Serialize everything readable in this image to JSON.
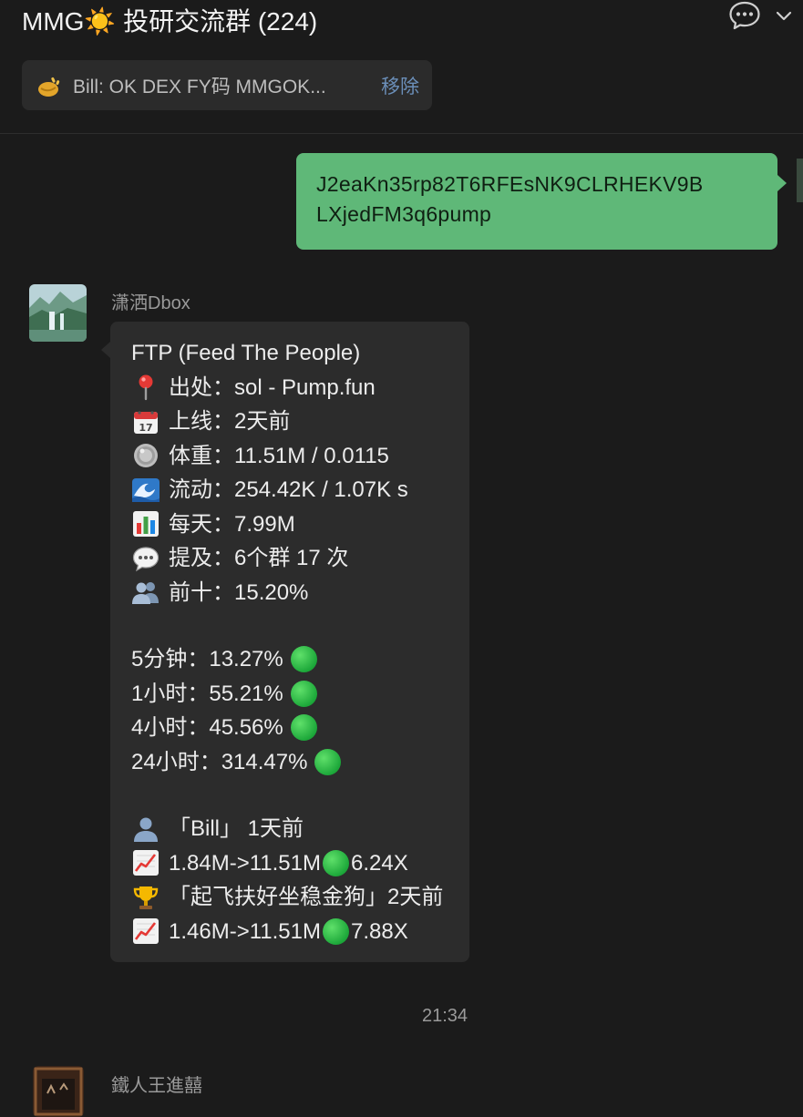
{
  "header": {
    "title": "MMG☀️ 投研交流群 (224)",
    "icons": [
      "chat-bubble-icon",
      "chevron-down-icon"
    ]
  },
  "pinned": {
    "icon": "pinned-emoji-icon",
    "text": "Bill: OK DEX FY码  MMGOK...",
    "remove_label": "移除"
  },
  "messages": {
    "outgoing": {
      "line1": "J2eaKn35rp82T6RFEsNK9CLRHEKV9B",
      "line2": "LXjedFM3q6pump",
      "color": "#5fb878"
    },
    "incoming1": {
      "sender": "潇洒Dbox",
      "lines": {
        "title": "FTP (Feed The People)",
        "source": "出处：sol - Pump.fun",
        "online": "上线：2天前",
        "weight": "体重：11.51M / 0.0115",
        "liquidity": "流动：254.42K / 1.07K s",
        "daily": "每天：7.99M",
        "mentions": "提及：6个群 17 次",
        "top10": "前十：15.20%",
        "m5": "5分钟：13.27%",
        "h1": "1小时：55.21%",
        "h4": "4小时：45.56%",
        "h24": "24小时：314.47%",
        "caller1": "「Bill」 1天前",
        "caller1_stats_a": "1.84M->11.51M",
        "caller1_stats_b": "6.24X",
        "caller2": "「起飞扶好坐稳金狗」2天前",
        "caller2_stats_a": "1.46M->11.51M",
        "caller2_stats_b": "7.88X"
      },
      "status_color": "#1da83a"
    },
    "timestamp": "21:34",
    "incoming2": {
      "sender": "鐵人王進囍"
    }
  }
}
